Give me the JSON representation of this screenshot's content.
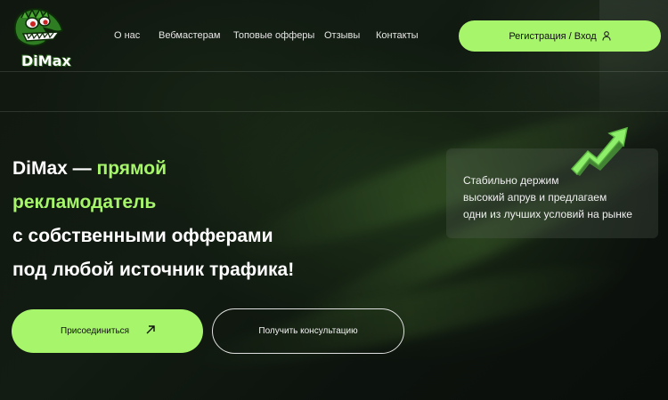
{
  "brand": {
    "logo_text": "DiMax"
  },
  "nav": {
    "items": [
      {
        "label": "О нас"
      },
      {
        "label": "Вебмастерам"
      },
      {
        "label": "Топовые офферы"
      },
      {
        "label": "Отзывы"
      },
      {
        "label": "Контакты"
      }
    ]
  },
  "header": {
    "register_label": "Регистрация / Вход"
  },
  "hero": {
    "line1_prefix": "DiMax — ",
    "line1_accent": "прямой",
    "line2_accent": "рекламодатель",
    "line3": "с собственными офферами",
    "line4": "под любой источник трафика!"
  },
  "card": {
    "lines": [
      "Стабильно держим",
      "высокий апрув и предлагаем",
      "одни из лучших условий на рынке"
    ]
  },
  "actions": {
    "join_label": "Присоединиться",
    "consult_label": "Получить консультацию"
  },
  "colors": {
    "accent": "#a6f56a",
    "background": "#0d120e"
  },
  "icons": {
    "user": "user-icon",
    "arrow": "arrow-up-right-icon",
    "trend": "trend-arrow-icon"
  }
}
